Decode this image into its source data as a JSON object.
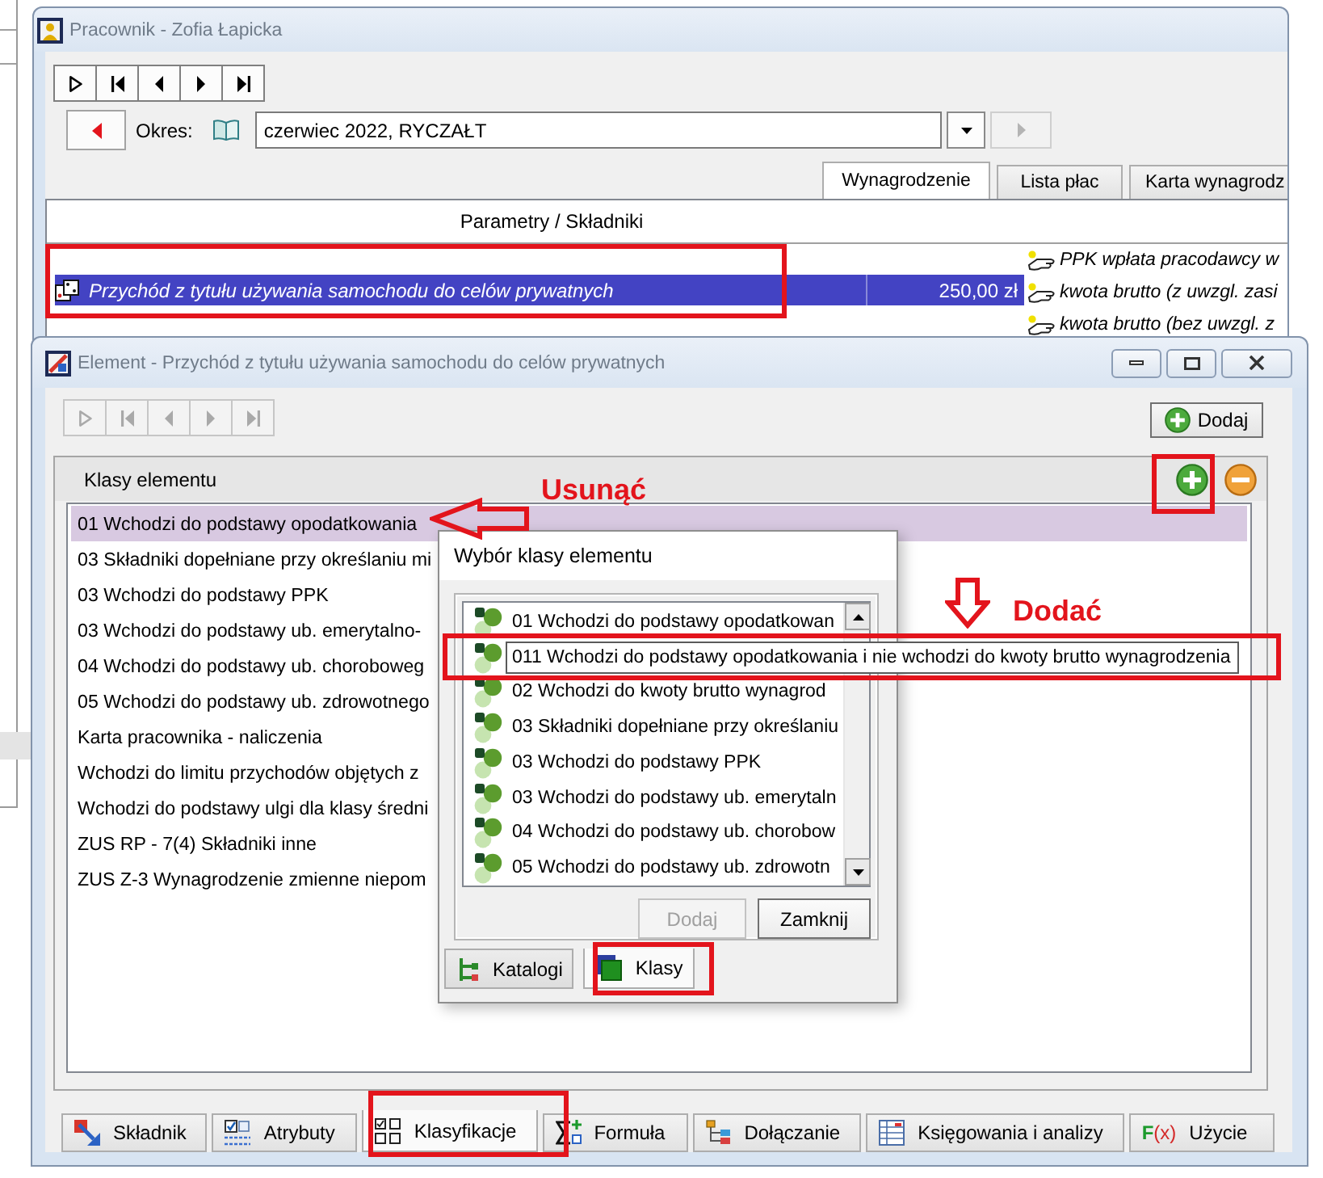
{
  "background_window": {
    "title": "Pracownik - Zofia Łapicka",
    "navigation": {
      "disabled": false
    },
    "period_label": "Okres:",
    "period_value": "czerwiec 2022, RYCZAŁT",
    "period_next": {
      "disabled": true
    },
    "tabs": [
      {
        "label": "Wynagrodzenie",
        "selected": true
      },
      {
        "label": "Lista płac",
        "selected": false
      },
      {
        "label": "Karta wynagrodz",
        "selected": false
      }
    ],
    "table": {
      "header": "Parametry / Składniki",
      "rows": [
        {
          "name": "Przychód z tytułu używania samochodu do celów prywatnych",
          "amount": "250,00 zł",
          "selected": true
        }
      ]
    },
    "values": [
      "PPK wpłata pracodawcy w",
      "kwota brutto (z uwzgl. zasi",
      "kwota brutto (bez uwzgl. z"
    ]
  },
  "element_window": {
    "title": "Element - Przychód z tytułu używania samochodu do celów prywatnych",
    "navigation": {
      "disabled": true
    },
    "add_button": "Dodaj",
    "panel_title": "Klasy elementu",
    "classes": [
      {
        "label": "01 Wchodzi do podstawy opodatkowania",
        "selected": true
      },
      {
        "label": "03 Składniki dopełniane przy określaniu mi",
        "selected": false
      },
      {
        "label": "03 Wchodzi do podstawy PPK",
        "selected": false
      },
      {
        "label": "03 Wchodzi do podstawy ub. emerytalno-",
        "selected": false
      },
      {
        "label": "04 Wchodzi do podstawy ub. choroboweg",
        "selected": false
      },
      {
        "label": "05 Wchodzi do podstawy ub. zdrowotnego",
        "selected": false
      },
      {
        "label": "Karta pracownika - naliczenia",
        "selected": false
      },
      {
        "label": "Wchodzi do limitu przychodów objętych z",
        "selected": false
      },
      {
        "label": "Wchodzi do podstawy ulgi dla klasy średni",
        "selected": false
      },
      {
        "label": "ZUS RP - 7(4) Składniki inne",
        "selected": false
      },
      {
        "label": "ZUS Z-3 Wynagrodzenie zmienne niepom",
        "selected": false
      }
    ],
    "tabs": [
      {
        "label": "Składnik",
        "kind": "component",
        "selected": false
      },
      {
        "label": "Atrybuty",
        "kind": "attributes",
        "selected": false
      },
      {
        "label": "Klasyfikacje",
        "kind": "classification",
        "selected": true
      },
      {
        "label": "Formuła",
        "kind": "formula",
        "selected": false
      },
      {
        "label": "Dołączanie",
        "kind": "attachment",
        "selected": false
      },
      {
        "label": "Księgowania i analizy",
        "kind": "accounting",
        "selected": false
      },
      {
        "label": "Użycie",
        "kind": "function",
        "icon_text": [
          "F",
          "(x)"
        ],
        "selected": false
      }
    ]
  },
  "class_picker": {
    "title": "Wybór klasy elementu",
    "items": [
      {
        "label": "01 Wchodzi do podstawy opodatkowan",
        "hovered": false
      },
      {
        "label": "011 Wchodzi do podstawy opodatkowania i nie wchodzi do kwoty brutto wynagrodzenia",
        "hovered": true
      },
      {
        "label": "02 Wchodzi do kwoty brutto wynagrod",
        "hovered": false
      },
      {
        "label": "03 Składniki dopełniane przy określaniu",
        "hovered": false
      },
      {
        "label": "03 Wchodzi do podstawy PPK",
        "hovered": false
      },
      {
        "label": "03 Wchodzi do podstawy ub. emerytaln",
        "hovered": false
      },
      {
        "label": "04 Wchodzi do podstawy ub. chorobow",
        "hovered": false
      },
      {
        "label": "05 Wchodzi do podstawy ub. zdrowotn",
        "hovered": false
      }
    ],
    "buttons": [
      {
        "label": "Dodaj",
        "disabled": true
      },
      {
        "label": "Zamknij",
        "disabled": false
      }
    ],
    "tabs": [
      {
        "label": "Katalogi",
        "kind": "tree",
        "selected": false
      },
      {
        "label": "Klasy",
        "kind": "squares",
        "selected": true
      }
    ]
  },
  "annotations": [
    {
      "kind": "frame"
    },
    {
      "kind": "frame"
    },
    {
      "kind": "frame"
    },
    {
      "kind": "frame"
    },
    {
      "kind": "frame"
    },
    {
      "kind": "arrow-left"
    },
    {
      "kind": "label",
      "text": "Usunąć"
    },
    {
      "kind": "arrow-down"
    },
    {
      "kind": "label",
      "text": "Dodać"
    }
  ]
}
